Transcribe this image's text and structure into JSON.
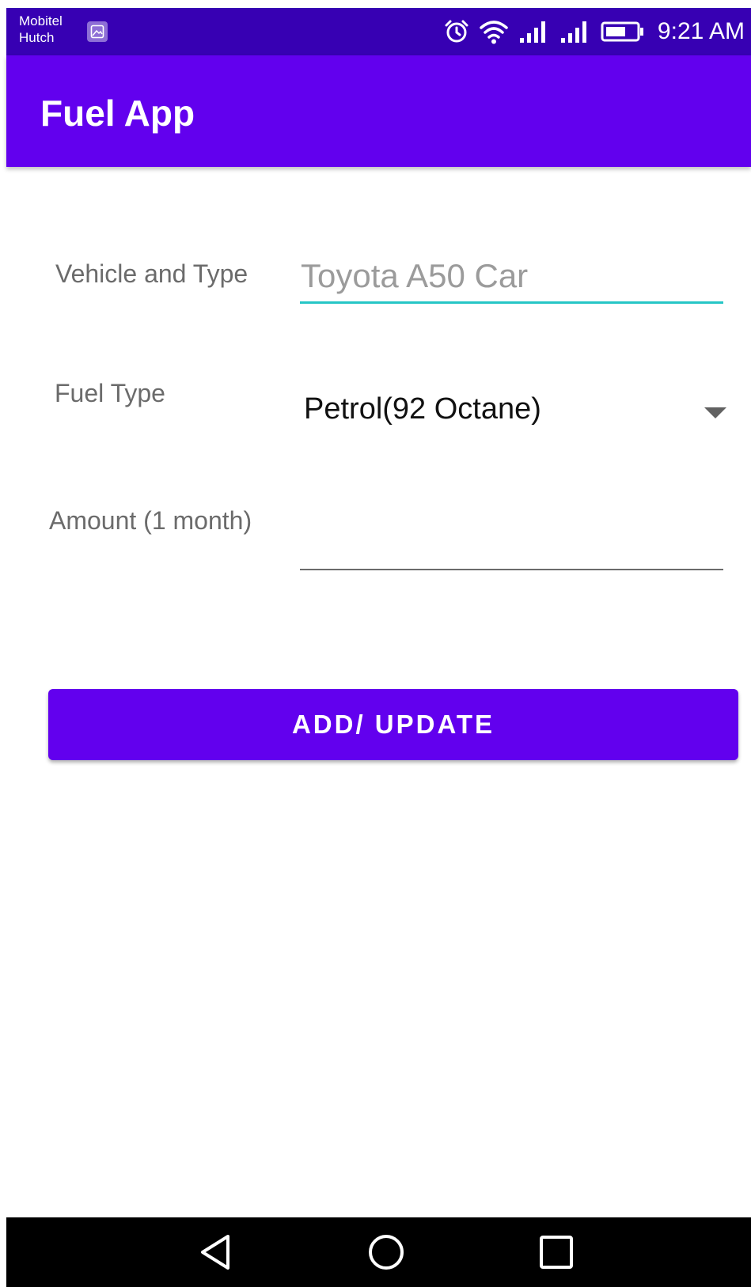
{
  "status_bar": {
    "carrier_line1": "Mobitel",
    "carrier_line2": "Hutch",
    "time": "9:21 AM",
    "icons": [
      "image-notification-icon",
      "alarm-icon",
      "wifi-icon",
      "signal-icon",
      "signal-icon",
      "battery-icon"
    ]
  },
  "app_bar": {
    "title": "Fuel App"
  },
  "form": {
    "vehicle_label": "Vehicle and Type",
    "vehicle_placeholder": "Toyota A50 Car",
    "fuel_type_label": "Fuel Type",
    "fuel_type_selected": "Petrol(92 Octane)",
    "amount_label": "Amount (1 month)",
    "amount_value": ""
  },
  "actions": {
    "submit_label": "ADD/ UPDATE"
  },
  "nav_bar": {
    "icons": [
      "back-icon",
      "home-icon",
      "recents-icon"
    ]
  },
  "colors": {
    "status_bar": "#3700b3",
    "primary": "#6200ee",
    "focus_underline": "#26c6c6",
    "underline": "#6b6b6b"
  }
}
